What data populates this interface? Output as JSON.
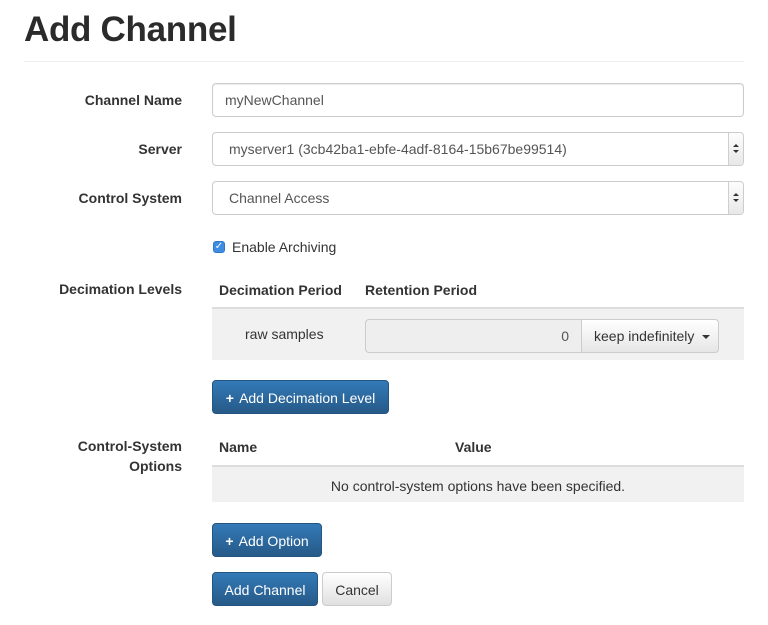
{
  "page": {
    "title": "Add Channel"
  },
  "form": {
    "channel_name": {
      "label": "Channel Name",
      "value": "myNewChannel"
    },
    "server": {
      "label": "Server",
      "value": "myserver1 (3cb42ba1-ebfe-4adf-8164-15b67be99514)"
    },
    "control_system": {
      "label": "Control System",
      "value": "Channel Access"
    },
    "enable_archiving": {
      "label": "Enable Archiving",
      "checked": true
    }
  },
  "decimation": {
    "label": "Decimation Levels",
    "headers": {
      "period": "Decimation Period",
      "retention": "Retention Period"
    },
    "rows": [
      {
        "period": "raw samples",
        "retention_value": "0",
        "retention_unit": "keep indefinitely"
      }
    ],
    "add_button": "Add Decimation Level"
  },
  "options": {
    "label_line1": "Control-System",
    "label_line2": "Options",
    "headers": {
      "name": "Name",
      "value": "Value"
    },
    "empty_message": "No control-system options have been specified.",
    "add_button": "Add Option"
  },
  "actions": {
    "submit": "Add Channel",
    "cancel": "Cancel"
  }
}
